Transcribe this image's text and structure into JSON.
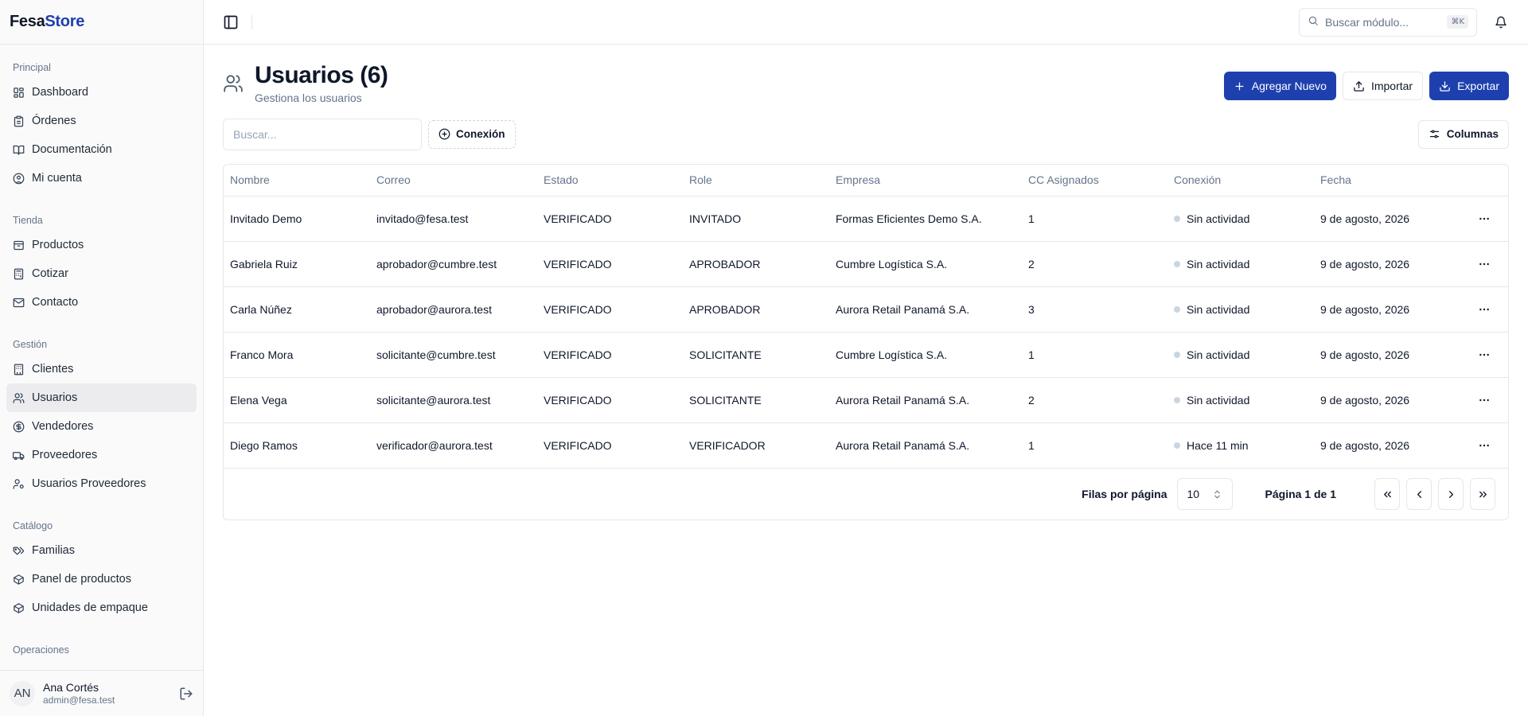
{
  "brand": {
    "part1": "Fesa",
    "part2": "Store"
  },
  "sidebar": {
    "groups": [
      {
        "label": "Principal",
        "items": [
          {
            "label": "Dashboard",
            "icon": "layout-dashboard-icon"
          },
          {
            "label": "Órdenes",
            "icon": "clipboard-list-icon"
          },
          {
            "label": "Documentación",
            "icon": "book-open-icon"
          },
          {
            "label": "Mi cuenta",
            "icon": "user-circle-icon"
          }
        ]
      },
      {
        "label": "Tienda",
        "items": [
          {
            "label": "Productos",
            "icon": "package-icon"
          },
          {
            "label": "Cotizar",
            "icon": "calculator-icon"
          },
          {
            "label": "Contacto",
            "icon": "mail-icon"
          }
        ]
      },
      {
        "label": "Gestión",
        "items": [
          {
            "label": "Clientes",
            "icon": "building-icon"
          },
          {
            "label": "Usuarios",
            "icon": "users-icon"
          },
          {
            "label": "Vendedores",
            "icon": "dollar-circle-icon"
          },
          {
            "label": "Proveedores",
            "icon": "truck-icon"
          },
          {
            "label": "Usuarios Proveedores",
            "icon": "user-cog-icon"
          }
        ]
      },
      {
        "label": "Catálogo",
        "items": [
          {
            "label": "Familias",
            "icon": "tags-icon"
          },
          {
            "label": "Panel de productos",
            "icon": "box-icon"
          },
          {
            "label": "Unidades de empaque",
            "icon": "box-icon"
          }
        ]
      },
      {
        "label": "Operaciones",
        "items": []
      }
    ],
    "active": "Usuarios",
    "user": {
      "initials": "AN",
      "name": "Ana Cortés",
      "email": "admin@fesa.test"
    }
  },
  "topbar": {
    "search_placeholder": "Buscar módulo...",
    "shortcut": "⌘K"
  },
  "page": {
    "title": "Usuarios (6)",
    "subtitle": "Gestiona los usuarios",
    "actions": {
      "add": "Agregar Nuevo",
      "import": "Importar",
      "export": "Exportar"
    },
    "filter_placeholder": "Buscar...",
    "filter_chip": "Conexión",
    "columns_button": "Columnas"
  },
  "table": {
    "headers": [
      "Nombre",
      "Correo",
      "Estado",
      "Role",
      "Empresa",
      "CC Asignados",
      "Conexión",
      "Fecha"
    ],
    "rows": [
      {
        "nombre": "Invitado Demo",
        "correo": "invitado@fesa.test",
        "estado": "VERIFICADO",
        "role": "INVITADO",
        "empresa": "Formas Eficientes Demo S.A.",
        "cc": "1",
        "conexion": "Sin actividad",
        "fecha": "9 de agosto, 2026"
      },
      {
        "nombre": "Gabriela Ruiz",
        "correo": "aprobador@cumbre.test",
        "estado": "VERIFICADO",
        "role": "APROBADOR",
        "empresa": "Cumbre Logística S.A.",
        "cc": "2",
        "conexion": "Sin actividad",
        "fecha": "9 de agosto, 2026"
      },
      {
        "nombre": "Carla Núñez",
        "correo": "aprobador@aurora.test",
        "estado": "VERIFICADO",
        "role": "APROBADOR",
        "empresa": "Aurora Retail Panamá S.A.",
        "cc": "3",
        "conexion": "Sin actividad",
        "fecha": "9 de agosto, 2026"
      },
      {
        "nombre": "Franco Mora",
        "correo": "solicitante@cumbre.test",
        "estado": "VERIFICADO",
        "role": "SOLICITANTE",
        "empresa": "Cumbre Logística S.A.",
        "cc": "1",
        "conexion": "Sin actividad",
        "fecha": "9 de agosto, 2026"
      },
      {
        "nombre": "Elena Vega",
        "correo": "solicitante@aurora.test",
        "estado": "VERIFICADO",
        "role": "SOLICITANTE",
        "empresa": "Aurora Retail Panamá S.A.",
        "cc": "2",
        "conexion": "Sin actividad",
        "fecha": "9 de agosto, 2026"
      },
      {
        "nombre": "Diego Ramos",
        "correo": "verificador@aurora.test",
        "estado": "VERIFICADO",
        "role": "VERIFICADOR",
        "empresa": "Aurora Retail Panamá S.A.",
        "cc": "1",
        "conexion": "Hace 11 min",
        "fecha": "9 de agosto, 2026"
      }
    ]
  },
  "pagination": {
    "rows_label": "Filas por página",
    "rows_value": "10",
    "page_info": "Página 1 de 1"
  },
  "colors": {
    "primary": "#1e40af",
    "border": "#e5e7eb",
    "muted": "#64748b",
    "status_dot": "#cbd5e1"
  }
}
